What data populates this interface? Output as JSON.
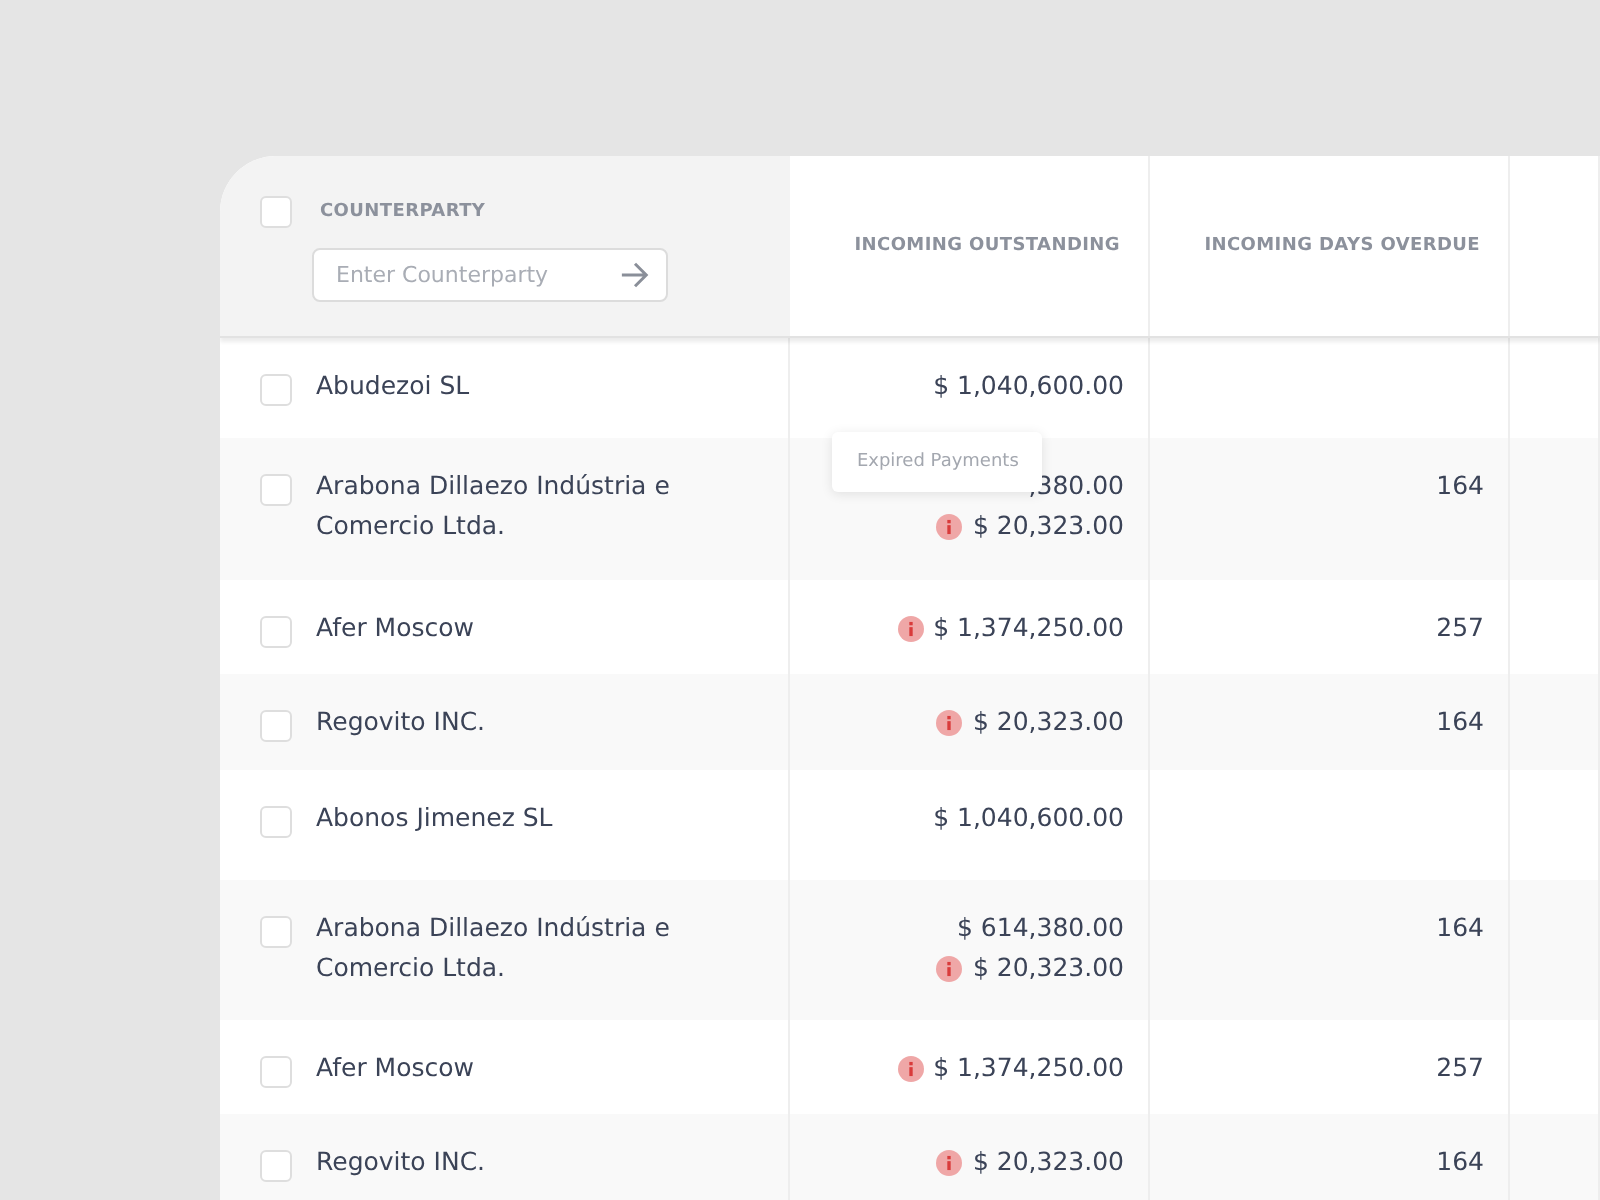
{
  "header": {
    "select_all": {
      "checked": false
    },
    "columns": [
      "COUNTERPARTY",
      "INCOMING OUTSTANDING",
      "INCOMING DAYS OVERDUE"
    ],
    "search": {
      "placeholder": "Enter Counterparty"
    }
  },
  "rows": [
    {
      "checked": false,
      "name": "Abudezoi SL",
      "amounts": [
        {
          "value": "$ 1,040,600.00",
          "expired": false
        }
      ],
      "days_overdue": ""
    },
    {
      "checked": false,
      "name": "Arabona Dillaezo Indústria e Comercio Ltda.",
      "amounts": [
        {
          "value": ",380.00",
          "expired": false
        },
        {
          "value": "$ 20,323.00",
          "expired": true,
          "tooltip": "Expired Payments"
        }
      ],
      "days_overdue": "164"
    },
    {
      "checked": false,
      "name": "Afer Moscow",
      "amounts": [
        {
          "value": "$ 1,374,250.00",
          "expired": true
        }
      ],
      "days_overdue": "257"
    },
    {
      "checked": false,
      "name": "Regovito INC.",
      "amounts": [
        {
          "value": "$ 20,323.00",
          "expired": true
        }
      ],
      "days_overdue": "164"
    },
    {
      "checked": false,
      "name": "Abonos Jimenez SL",
      "amounts": [
        {
          "value": "$ 1,040,600.00",
          "expired": false
        }
      ],
      "days_overdue": ""
    },
    {
      "checked": false,
      "name": "Arabona Dillaezo Indústria e Comercio Ltda.",
      "amounts": [
        {
          "value": "$ 614,380.00",
          "expired": false
        },
        {
          "value": "$ 20,323.00",
          "expired": true
        }
      ],
      "days_overdue": "164"
    },
    {
      "checked": false,
      "name": "Afer Moscow",
      "amounts": [
        {
          "value": "$ 1,374,250.00",
          "expired": true
        }
      ],
      "days_overdue": "257"
    },
    {
      "checked": false,
      "name": "Regovito INC.",
      "amounts": [
        {
          "value": "$ 20,323.00",
          "expired": true
        }
      ],
      "days_overdue": "164"
    }
  ]
}
